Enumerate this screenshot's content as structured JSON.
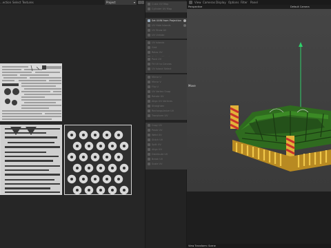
{
  "uv_editor": {
    "menu": [
      "...ection",
      "Select",
      "Textures"
    ],
    "project_select": "Project"
  },
  "command_panel": {
    "groups": [
      {
        "items": [
          {
            "label": "Cubic UV Map",
            "active": false
          },
          {
            "label": "Cylinder UV Map",
            "active": false
          }
        ]
      },
      {
        "items": [
          {
            "label": "Set UVW from Projection",
            "active": true
          },
          {
            "label": "UV Hide Islands",
            "active": false
          },
          {
            "label": "UV Show All",
            "active": false
          },
          {
            "label": "UV Unhide",
            "active": false
          }
        ]
      },
      {
        "items": [
          {
            "label": "UV Islands",
            "active": false
          },
          {
            "label": "Grid",
            "active": false
          },
          {
            "label": "Relax UV",
            "active": false
          },
          {
            "label": "Optimal Mapping",
            "active": false
          }
        ]
      },
      {
        "items": [
          {
            "label": "Pack UV",
            "active": false
          },
          {
            "label": "Fit UV to Canvas",
            "active": false
          },
          {
            "label": "UV Island Select",
            "active": false
          }
        ]
      },
      {
        "items": [
          {
            "label": "Mirror U",
            "active": false
          },
          {
            "label": "Mirror V",
            "active": false
          },
          {
            "label": "Flip U",
            "active": false
          },
          {
            "label": "UV Vertex Snap",
            "active": false
          },
          {
            "label": "Rotate UV",
            "active": false
          },
          {
            "label": "Align UV Vertices",
            "active": false
          },
          {
            "label": "Straighten",
            "active": false
          },
          {
            "label": "Rectangularize UV",
            "active": false
          },
          {
            "label": "Transform UV",
            "active": false
          }
        ]
      },
      {
        "items": [
          {
            "label": "Copy UV",
            "active": false
          },
          {
            "label": "Paste UV",
            "active": false
          },
          {
            "label": "Weld UV",
            "active": false
          },
          {
            "label": "Stitch UV",
            "active": false
          },
          {
            "label": "Split UV",
            "active": false
          },
          {
            "label": "Align UV",
            "active": false
          },
          {
            "label": "Distribute UV",
            "active": false
          },
          {
            "label": "Break UV",
            "active": false
          },
          {
            "label": "Scale UV",
            "active": false
          }
        ]
      }
    ]
  },
  "viewport": {
    "menu": [
      "View",
      "Cameras",
      "Display",
      "Options",
      "Filter",
      "Panel"
    ],
    "view_name": "Perspective",
    "camera": "Default Camera",
    "tool": "Move",
    "status": "View Transform: Scene"
  },
  "colors": {
    "tractor_green": "#2f6b1f",
    "tractor_yellow": "#e2b23a",
    "warning_red": "#c8322a",
    "axis_y": "#2fd06a"
  }
}
